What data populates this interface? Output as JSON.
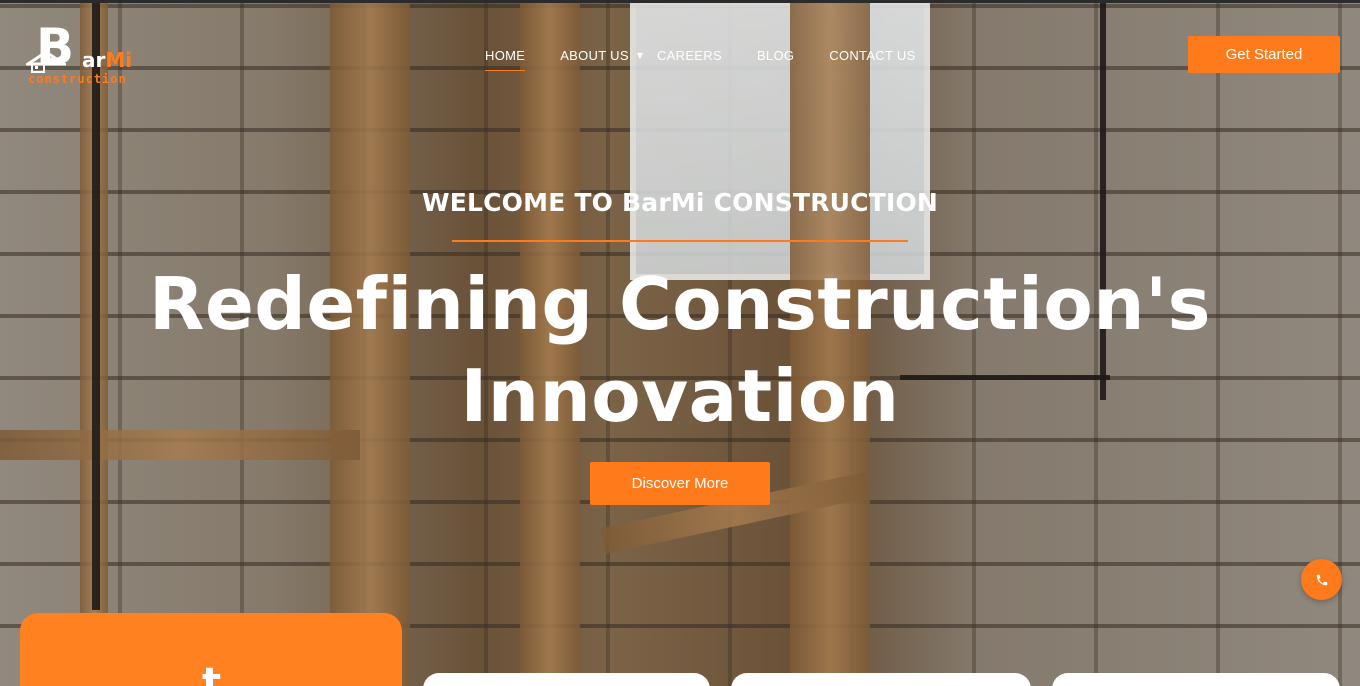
{
  "brand": {
    "logo_letter": "B",
    "logo_ar": "ar",
    "logo_mi": "Mi",
    "logo_tagline": "construction",
    "accent_color": "#ff7a1a"
  },
  "nav": {
    "items": [
      {
        "label": "HOME",
        "active": true
      },
      {
        "label": "ABOUT US",
        "has_dropdown": true
      },
      {
        "label": "CAREERS"
      },
      {
        "label": "BLOG"
      },
      {
        "label": "CONTACT US"
      }
    ],
    "cta_label": "Get Started"
  },
  "hero": {
    "welcome": "WELCOME TO BarMi CONSTRUCTION",
    "headline_line1": "Redefining Construction's",
    "headline_line2": "Innovation",
    "button_label": "Discover More"
  },
  "floating": {
    "icon": "phone-icon"
  },
  "bottom_cards": {
    "orange_card_glyph": "t"
  }
}
